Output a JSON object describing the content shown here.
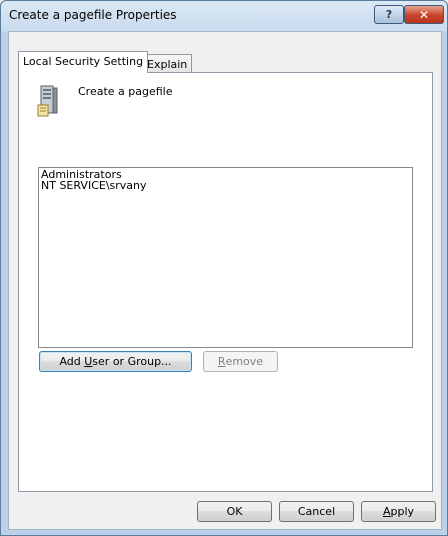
{
  "window": {
    "title": "Create a pagefile Properties",
    "help_label": "?",
    "close_label": "✕"
  },
  "tabs": [
    {
      "label": "Local Security Setting",
      "active": true
    },
    {
      "label": "Explain",
      "active": false
    }
  ],
  "setting": {
    "icon": "server-policy-icon",
    "name": "Create a pagefile"
  },
  "principals": [
    "Administrators",
    "NT SERVICE\\srvany"
  ],
  "buttons": {
    "add_pre": "Add ",
    "add_accel": "U",
    "add_post": "ser or Group...",
    "remove_accel": "R",
    "remove_post": "emove",
    "ok": "OK",
    "cancel": "Cancel",
    "apply_accel": "A",
    "apply_post": "pply"
  }
}
